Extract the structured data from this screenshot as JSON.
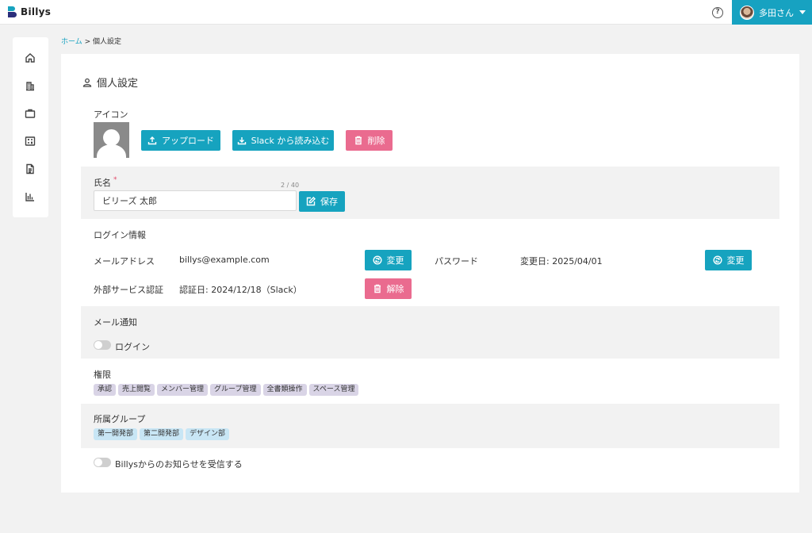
{
  "app": {
    "logo_text": "Billys"
  },
  "header": {
    "help_icon": "help-circle-icon",
    "help_glyph": "?",
    "user_name": "多田さん"
  },
  "sidebar": {
    "items": [
      {
        "icon": "home-icon"
      },
      {
        "icon": "building-icon"
      },
      {
        "icon": "briefcase-icon"
      },
      {
        "icon": "calculator-icon"
      },
      {
        "icon": "document-icon"
      },
      {
        "icon": "bar-chart-icon"
      }
    ]
  },
  "breadcrumb": {
    "home": "ホーム",
    "separator": " > ",
    "current": "個人設定"
  },
  "page": {
    "title": "個人設定"
  },
  "icon_section": {
    "label": "アイコン",
    "upload_label": "アップロード",
    "slack_import_label": "Slack から読み込む",
    "delete_label": "削除"
  },
  "name_section": {
    "label": "氏名",
    "required_mark": "*",
    "counter": "2 / 40",
    "value": "ビリーズ 太郎",
    "save_label": "保存"
  },
  "login_section": {
    "label": "ログイン情報",
    "email_label": "メールアドレス",
    "email_value": "billys@example.com",
    "email_change_label": "変更",
    "password_label": "パスワード",
    "password_value": "変更日: 2025/04/01",
    "password_change_label": "変更",
    "external_label": "外部サービス認証",
    "external_value": "認証日: 2024/12/18（Slack）",
    "external_release_label": "解除"
  },
  "mail_section": {
    "label": "メール通知",
    "login_toggle_label": "ログイン",
    "login_toggle_on": false
  },
  "permission_section": {
    "label": "権限",
    "chips": [
      "承認",
      "売上閲覧",
      "メンバー管理",
      "グループ管理",
      "全書類操作",
      "スペース管理"
    ]
  },
  "group_section": {
    "label": "所属グループ",
    "chips": [
      "第一開発部",
      "第二開発部",
      "デザイン部"
    ]
  },
  "notice_section": {
    "toggle_label": "Billysからのお知らせを受信する",
    "toggle_on": false
  },
  "colors": {
    "accent": "#16a3bf",
    "danger": "#ea6b8f",
    "brand_dark": "#2b2e7a"
  }
}
